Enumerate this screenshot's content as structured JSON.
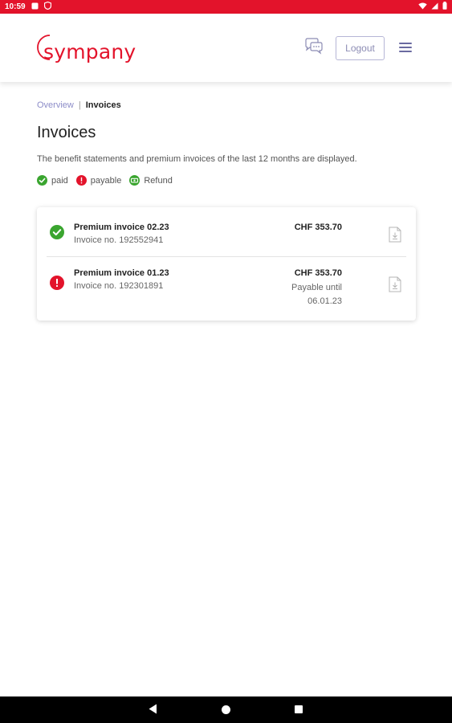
{
  "status_bar": {
    "time": "10:59",
    "icons": [
      "notification-icon",
      "shield-icon",
      "wifi-icon",
      "signal-icon",
      "battery-icon"
    ]
  },
  "header": {
    "logo_text": "sympany",
    "logout_label": "Logout",
    "chat_icon": "chat-bubbles-icon",
    "menu_icon": "hamburger-menu-icon"
  },
  "breadcrumb": {
    "overview": "Overview",
    "separator": "|",
    "current": "Invoices"
  },
  "page": {
    "title": "Invoices",
    "description": "The benefit statements and premium invoices of the last 12 months are displayed."
  },
  "legend": {
    "paid": "paid",
    "payable": "payable",
    "refund": "Refund"
  },
  "invoices": [
    {
      "title": "Premium invoice 02.23",
      "number": "Invoice no. 192552941",
      "amount": "CHF 353.70",
      "status": "paid"
    },
    {
      "title": "Premium invoice 01.23",
      "number": "Invoice no. 192301891",
      "amount": "CHF 353.70",
      "status": "payable",
      "payable_until_label": "Payable until",
      "payable_until_date": "06.01.23"
    }
  ],
  "colors": {
    "brand": "#e3132b",
    "paid": "#3aa52f",
    "payable": "#e3132b",
    "link": "#8c8cc8"
  }
}
